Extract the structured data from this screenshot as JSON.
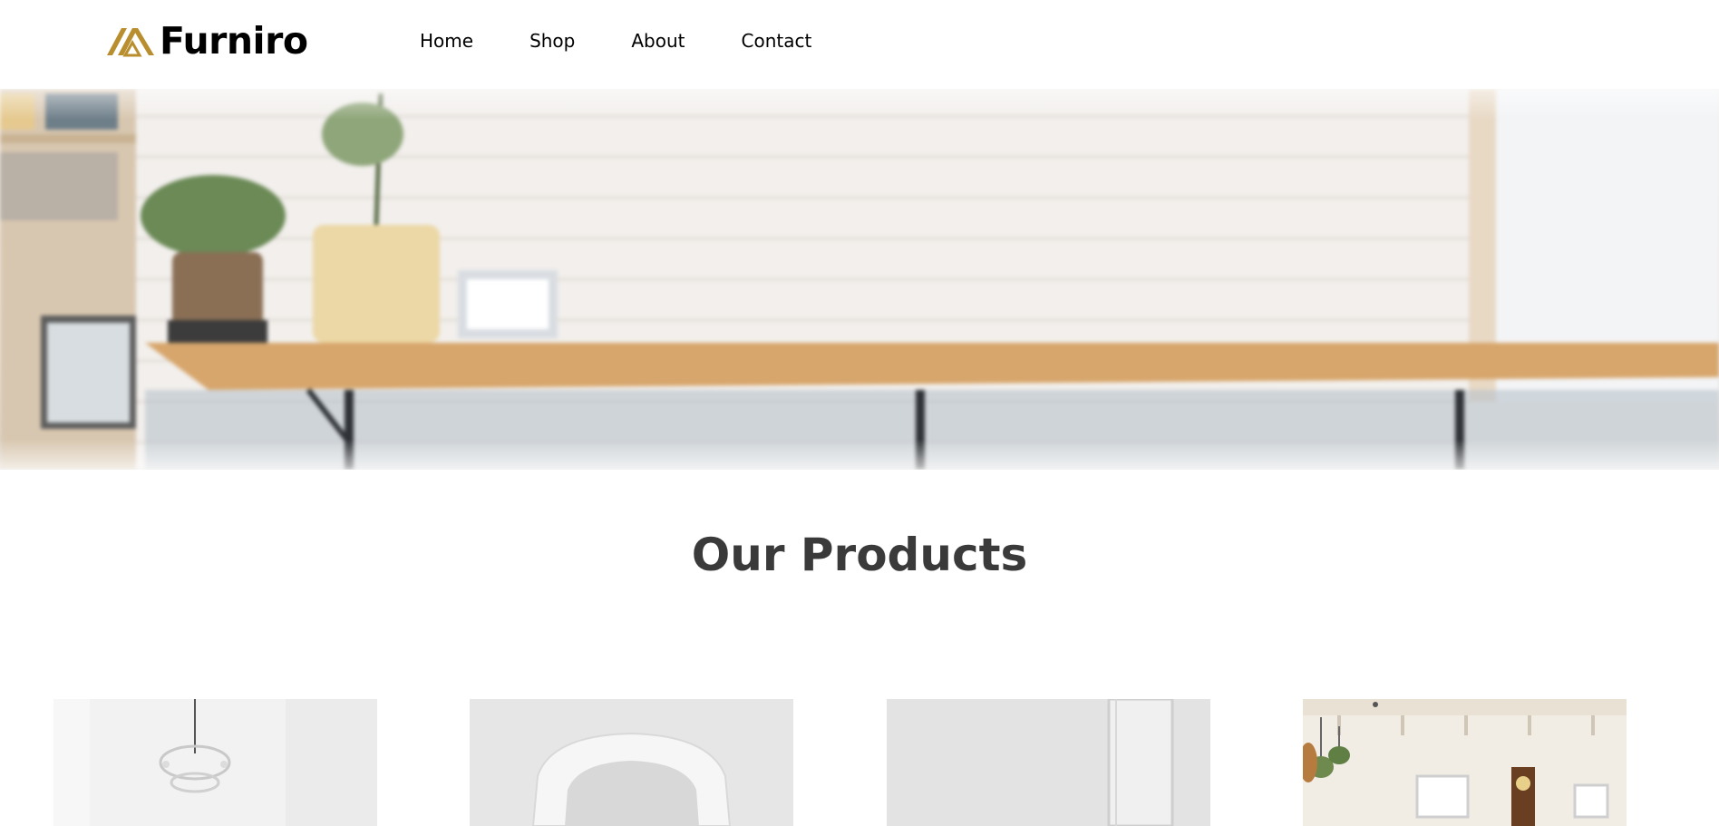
{
  "header": {
    "logo_text": "Furniro",
    "logo_icon": "furniro-logo-mark-icon",
    "brand_color": "#B88E2F",
    "nav": [
      {
        "label": "Home"
      },
      {
        "label": "Shop"
      },
      {
        "label": "About"
      },
      {
        "label": "Contact"
      }
    ]
  },
  "hero": {
    "image": "blurred-shelf-with-plants-photo"
  },
  "products": {
    "title": "Our Products",
    "items": [
      {
        "image": "chandelier-room-photo"
      },
      {
        "image": "white-chair-photo"
      },
      {
        "image": "white-door-room-photo"
      },
      {
        "image": "living-room-with-clock-photo"
      }
    ]
  }
}
